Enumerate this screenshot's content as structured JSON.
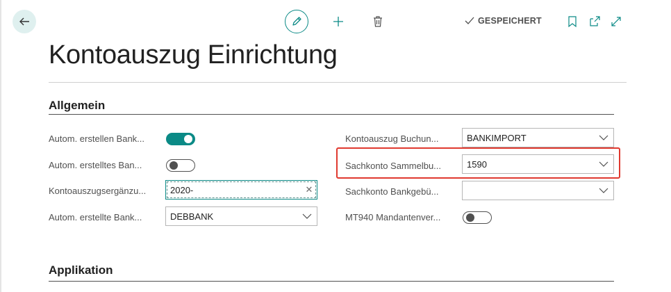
{
  "toolbar": {
    "saved_label": "GESPEICHERT",
    "icons": [
      "arrow-left-icon",
      "pencil-icon",
      "plus-icon",
      "trash-icon",
      "check-icon",
      "bookmark-icon",
      "popout-icon",
      "expand-icon"
    ]
  },
  "page": {
    "title": "Kontoauszug Einrichtung"
  },
  "sections": {
    "general": {
      "title": "Allgemein"
    },
    "application": {
      "title": "Applikation"
    }
  },
  "fields": {
    "left": [
      {
        "label": "Autom. erstellen Bank...",
        "type": "toggle",
        "on": true
      },
      {
        "label": "Autom. erstelltes Ban...",
        "type": "toggle",
        "on": false
      },
      {
        "label": "Kontoauszugsergänzu...",
        "type": "text",
        "value": "2020-"
      },
      {
        "label": "Autom. erstellte Bank...",
        "type": "select",
        "value": "DEBBANK"
      }
    ],
    "right": [
      {
        "label": "Kontoauszug Buchun...",
        "type": "select",
        "value": "BANKIMPORT"
      },
      {
        "label": "Sachkonto Sammelbu...",
        "type": "select",
        "value": "1590"
      },
      {
        "label": "Sachkonto Bankgebü...",
        "type": "select",
        "value": ""
      },
      {
        "label": "MT940 Mandantenver...",
        "type": "toggle",
        "on": false
      }
    ]
  },
  "colors": {
    "accent": "#0b8a86",
    "highlight": "#e0392f"
  }
}
